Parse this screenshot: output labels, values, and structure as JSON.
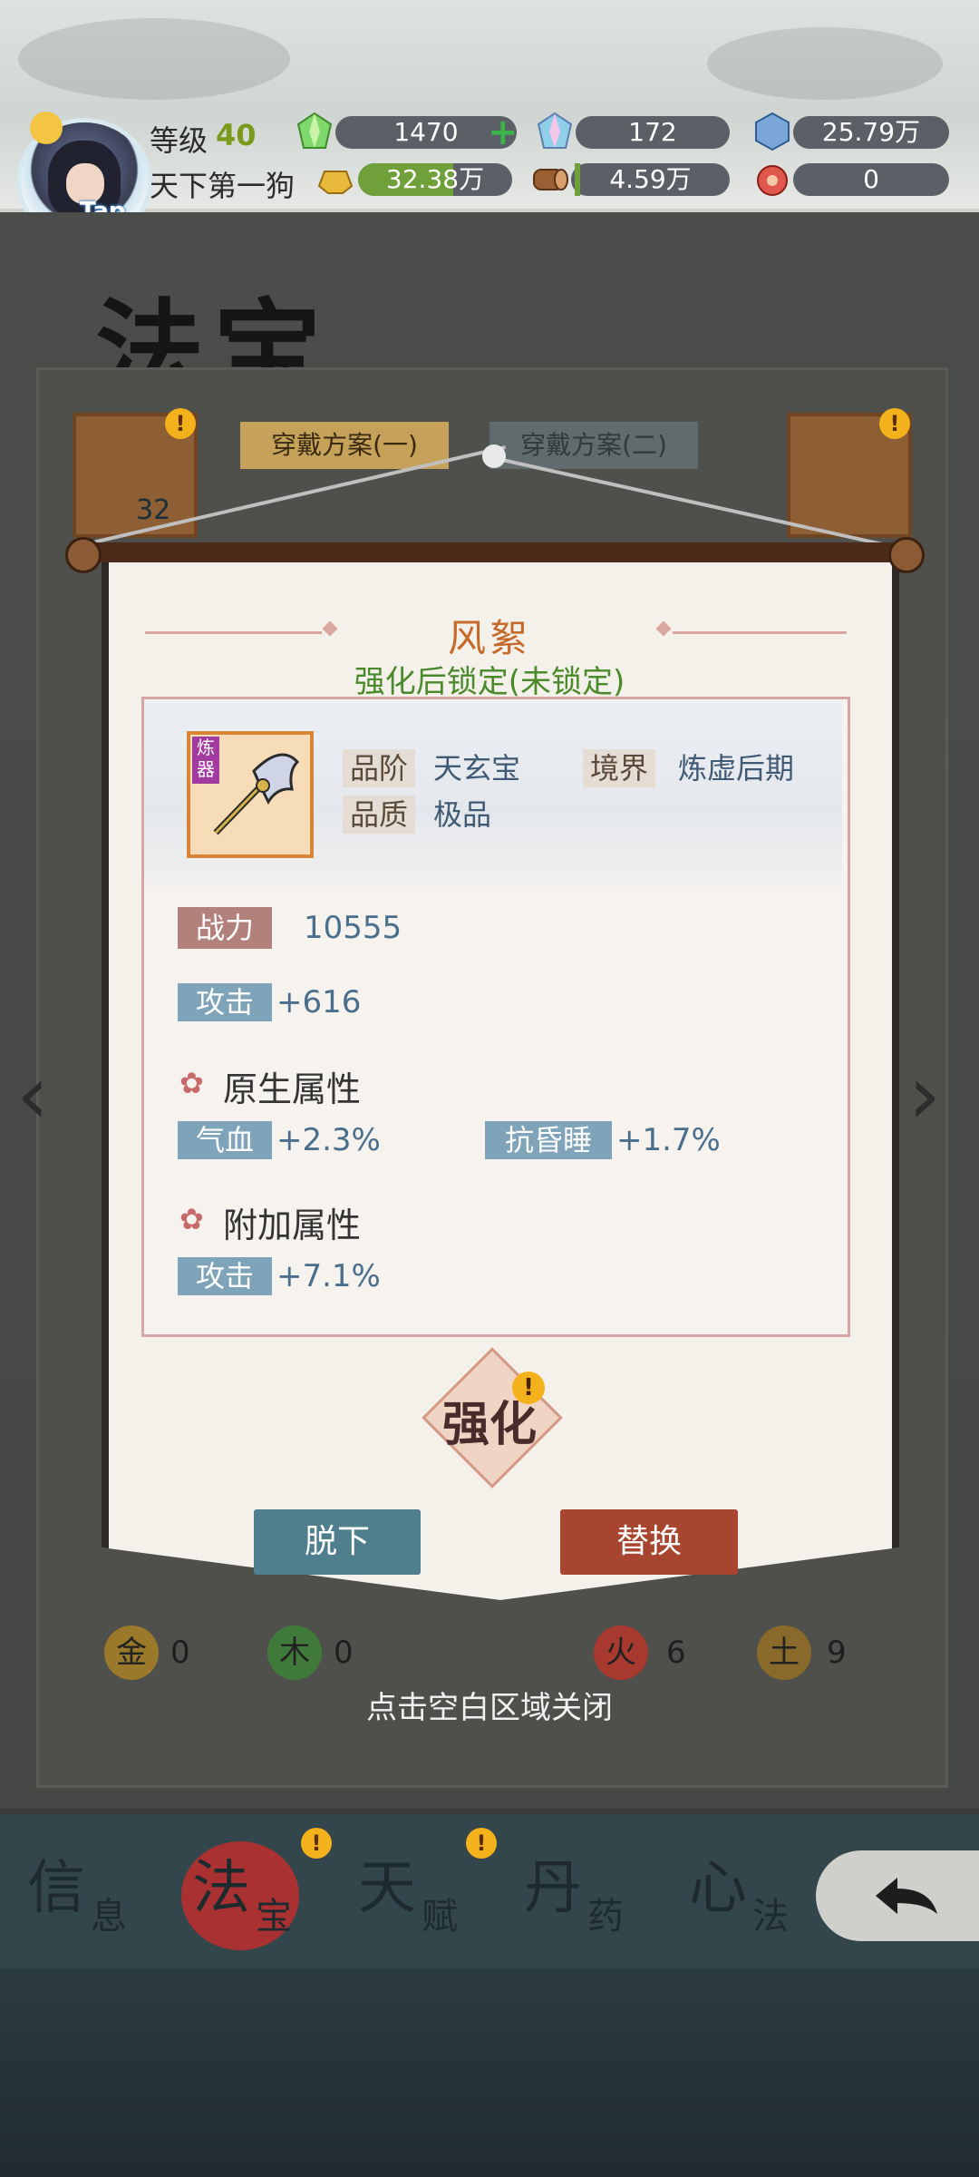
{
  "header": {
    "level_label": "等级",
    "level_value": "40",
    "player_name": "天下第一狗",
    "avatar_tag": "Tap",
    "resources": [
      {
        "icon": "green-crystal-icon",
        "value": "1470"
      },
      {
        "icon": "rainbow-crystal-icon",
        "value": "172"
      },
      {
        "icon": "blue-gem-icon",
        "value": "25.79万"
      },
      {
        "icon": "gold-ingot-icon",
        "value": "32.38万"
      },
      {
        "icon": "wood-log-icon",
        "value": "4.59万"
      },
      {
        "icon": "red-pill-icon",
        "value": "0"
      }
    ]
  },
  "page": {
    "title": "法宝",
    "tabs": [
      "穿戴方案(一)",
      "穿戴方案(二)"
    ],
    "slot_count_label": "32",
    "elements": [
      {
        "glyph": "金",
        "count": "0"
      },
      {
        "glyph": "木",
        "count": "0"
      },
      {
        "glyph": "火",
        "count": "6"
      },
      {
        "glyph": "土",
        "count": "9"
      }
    ]
  },
  "dialog": {
    "title": "风絮",
    "lock_status": "强化后锁定(未锁定)",
    "grade_label": "品阶",
    "grade_value": "天玄宝",
    "realm_label": "境界",
    "realm_value": "炼虚后期",
    "quality_label": "品质",
    "quality_value": "极品",
    "refine_tag": "炼器",
    "power_label": "战力",
    "power_value": "10555",
    "base_stat": {
      "label": "攻击",
      "value": "+616"
    },
    "native_title": "原生属性",
    "native_stats": [
      {
        "label": "气血",
        "value": "+2.3%"
      },
      {
        "label": "抗昏睡",
        "value": "+1.7%"
      }
    ],
    "extra_title": "附加属性",
    "extra_stats": [
      {
        "label": "攻击",
        "value": "+7.1%"
      }
    ],
    "enhance_label": "强化",
    "unequip_label": "脱下",
    "replace_label": "替换",
    "close_hint": "点击空白区域关闭"
  },
  "bottom_nav": [
    {
      "main": "信",
      "sub": "息"
    },
    {
      "main": "法",
      "sub": "宝"
    },
    {
      "main": "天",
      "sub": "赋"
    },
    {
      "main": "丹",
      "sub": "药"
    },
    {
      "main": "心",
      "sub": "法"
    }
  ],
  "colors": {
    "accent_orange": "#c56a2a",
    "lock_green": "#4a8a2a",
    "unequip_btn": "#4f7e8c",
    "replace_btn": "#a8452e"
  }
}
